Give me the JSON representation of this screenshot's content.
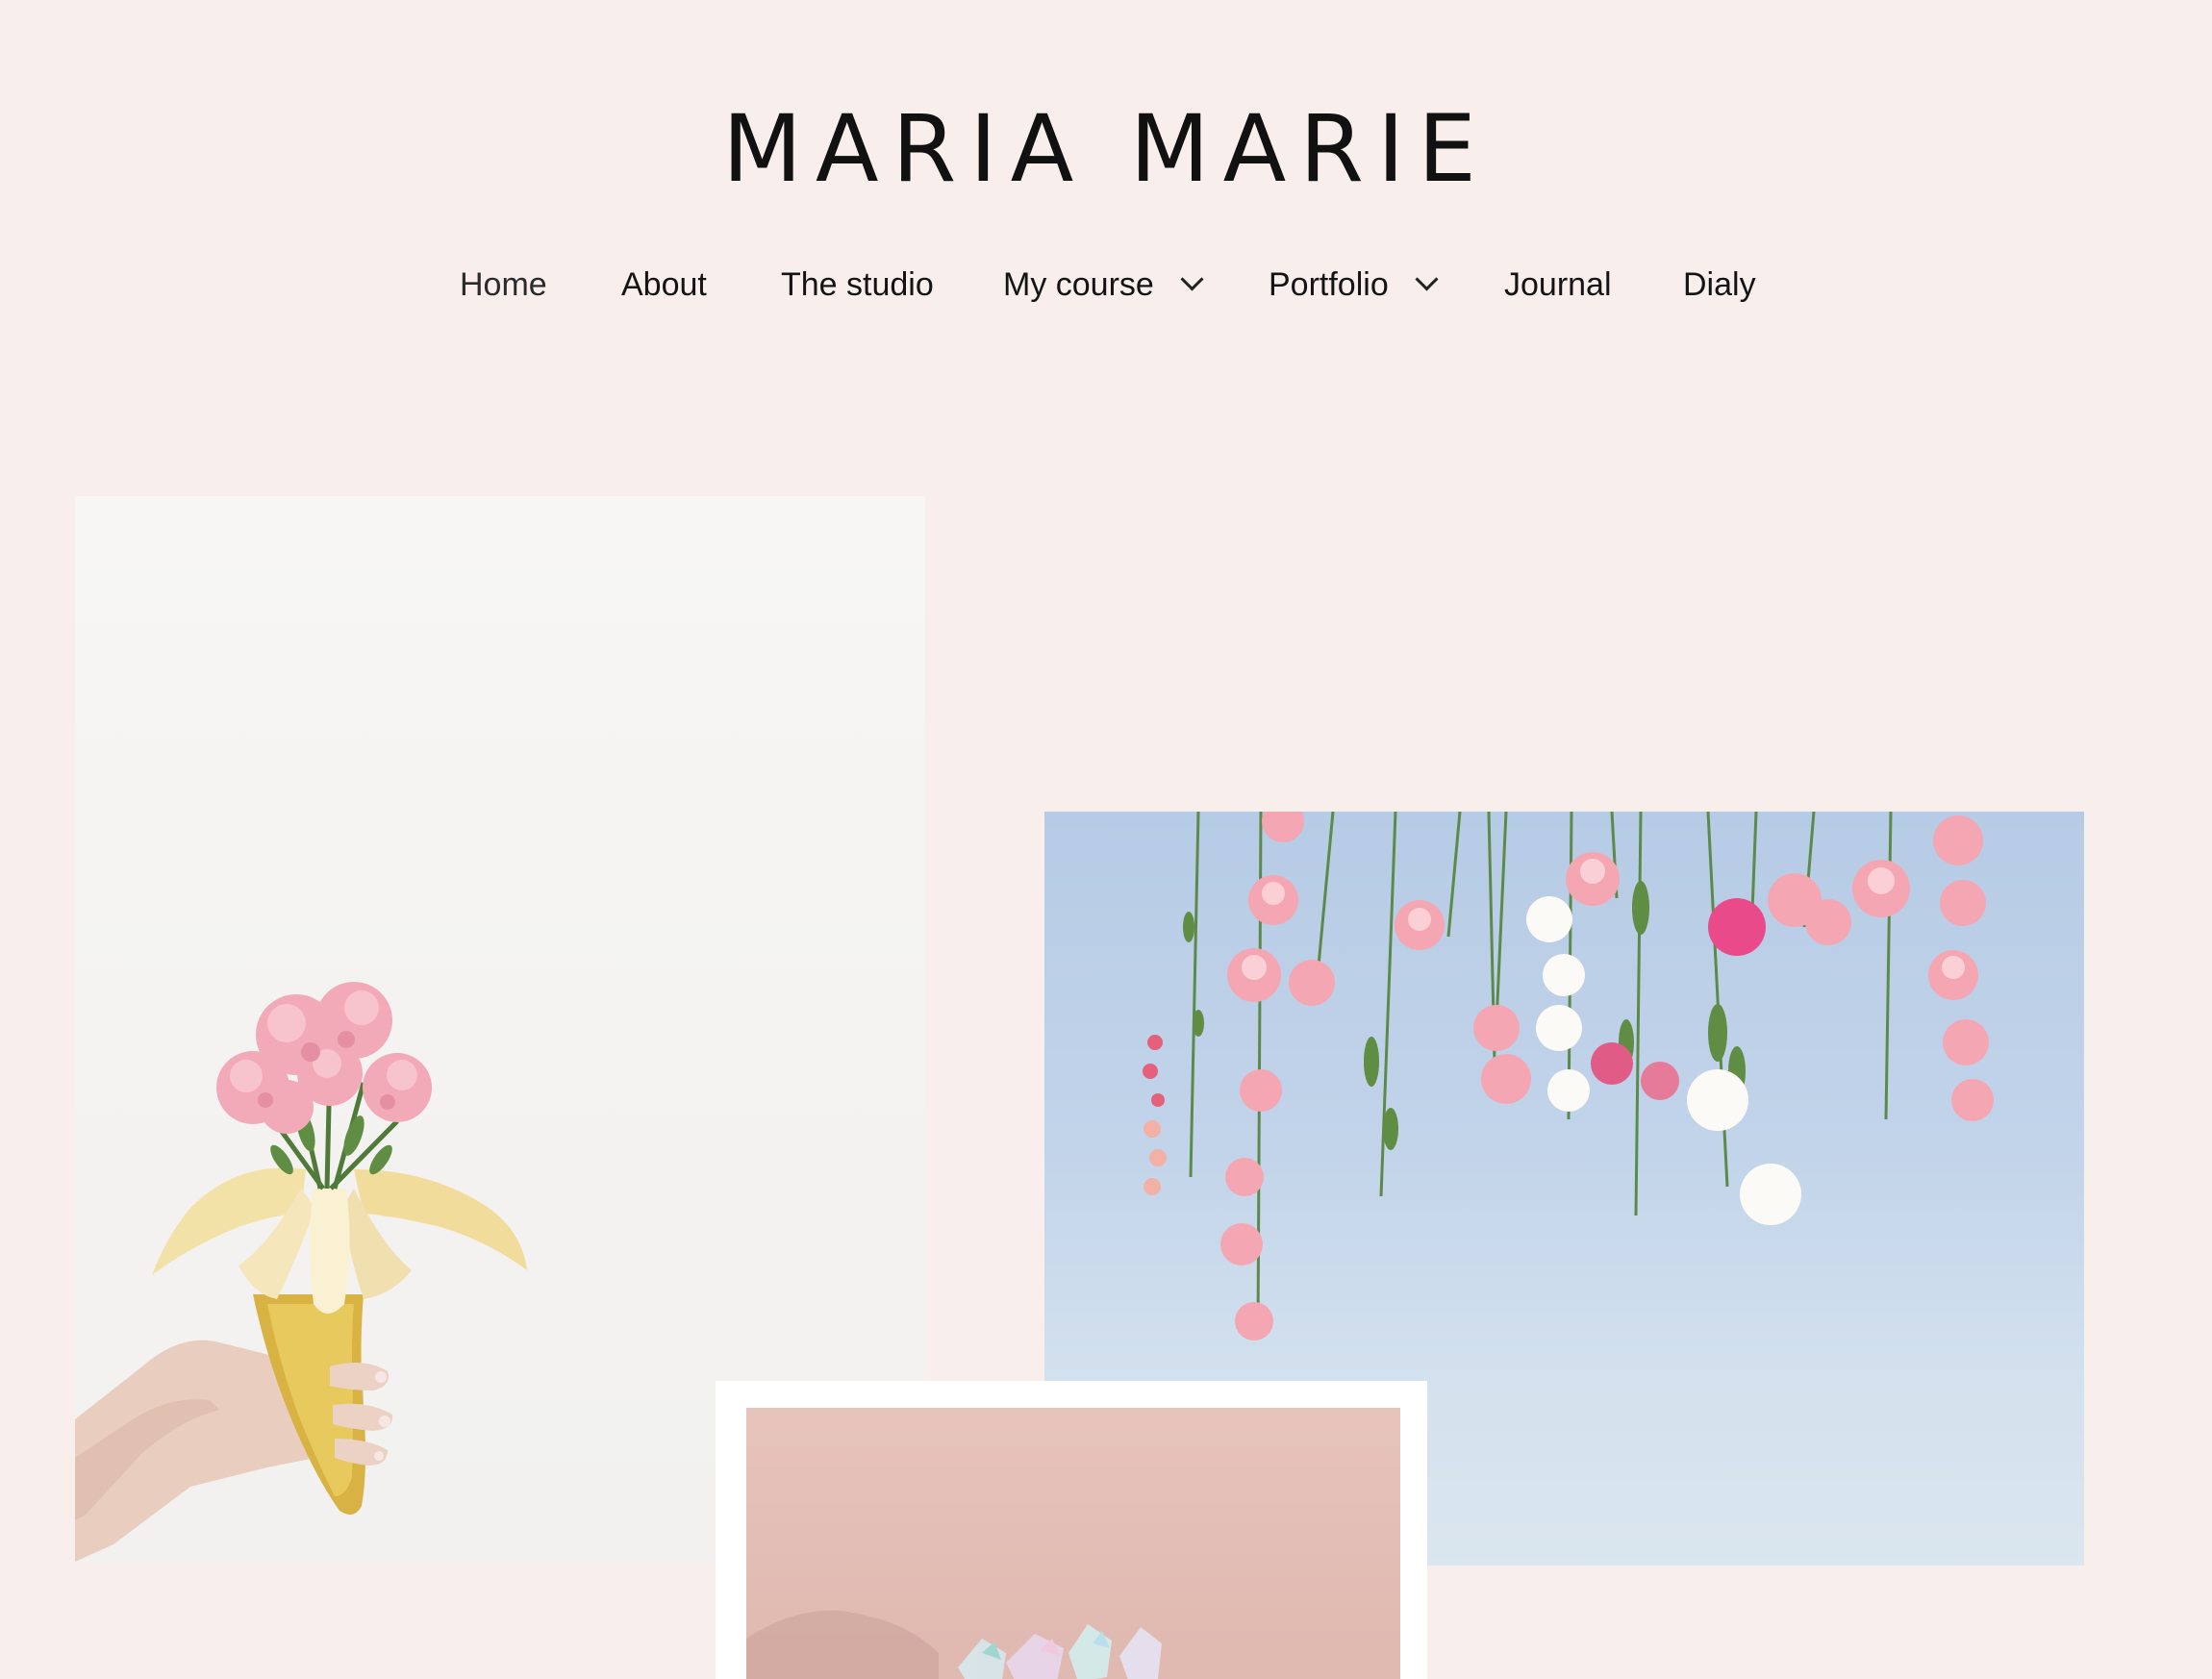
{
  "site": {
    "title": "MARIA MARIE"
  },
  "nav": {
    "items": [
      {
        "label": "Home",
        "has_dropdown": false
      },
      {
        "label": "About",
        "has_dropdown": false
      },
      {
        "label": "The studio",
        "has_dropdown": false
      },
      {
        "label": "My course",
        "has_dropdown": true,
        "icon": "chevron-down-icon"
      },
      {
        "label": "Portfolio",
        "has_dropdown": true,
        "icon": "chevron-down-icon"
      },
      {
        "label": "Journal",
        "has_dropdown": false
      },
      {
        "label": "Dialy",
        "has_dropdown": false
      }
    ]
  },
  "gallery": {
    "images": [
      {
        "subject": "hand holding banana with pink carnations"
      },
      {
        "subject": "hanging pink and white flowers against blue sky"
      },
      {
        "subject": "iridescent crystals on pink background"
      }
    ]
  },
  "colors": {
    "page_background": "#f8efed",
    "text": "#141414",
    "accent_pink": "#f2a9b8"
  }
}
